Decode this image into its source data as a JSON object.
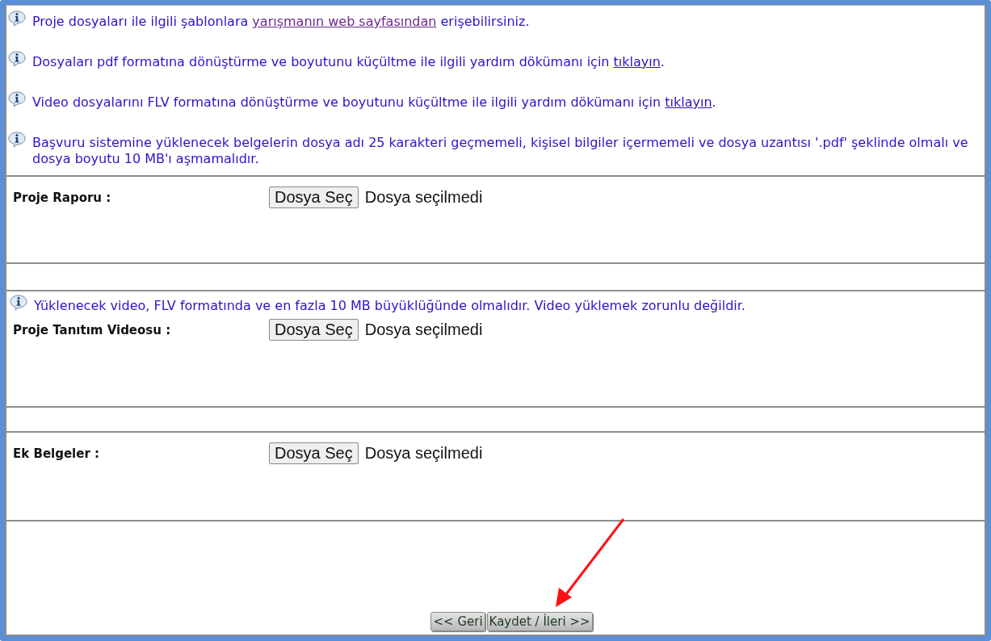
{
  "notes": [
    {
      "before": "Proje dosyaları ile ilgili şablonlara ",
      "link": "yarışmanın web sayfasından",
      "after": " erişebilirsiniz.",
      "visited": true
    },
    {
      "before": "Dosyaları pdf formatına dönüştürme ve boyutunu küçültme ile ilgili yardım dökümanı için ",
      "link": "tıklayın",
      "after": ".",
      "visited": false
    },
    {
      "before": "Video dosyalarını FLV formatına dönüştürme ve boyutunu küçültme ile ilgili yardım dökümanı için ",
      "link": "tıklayın",
      "after": ".",
      "visited": false
    },
    {
      "before": "Başvuru sistemine yüklenecek belgelerin dosya adı 25 karakteri geçmemeli, kişisel bilgiler içermemeli ve dosya uzantısı '.pdf' şeklinde olmalı ve dosya boyutu 10 MB'ı aşmamalıdır."
    }
  ],
  "uploads": [
    {
      "label": "Proje Raporu :",
      "button": "Dosya Seç",
      "status": "Dosya seçilmedi"
    },
    {
      "note": "Yüklenecek video, FLV formatında ve en fazla 10 MB büyüklüğünde olmalıdır. Video yüklemek zorunlu değildir.",
      "label": "Proje Tanıtım Videosu :",
      "button": "Dosya Seç",
      "status": "Dosya seçilmedi"
    },
    {
      "label": "Ek Belgeler :",
      "button": "Dosya Seç",
      "status": "Dosya seçilmedi"
    }
  ],
  "buttons": [
    "<< Geri",
    "Kaydet / İleri >>"
  ]
}
